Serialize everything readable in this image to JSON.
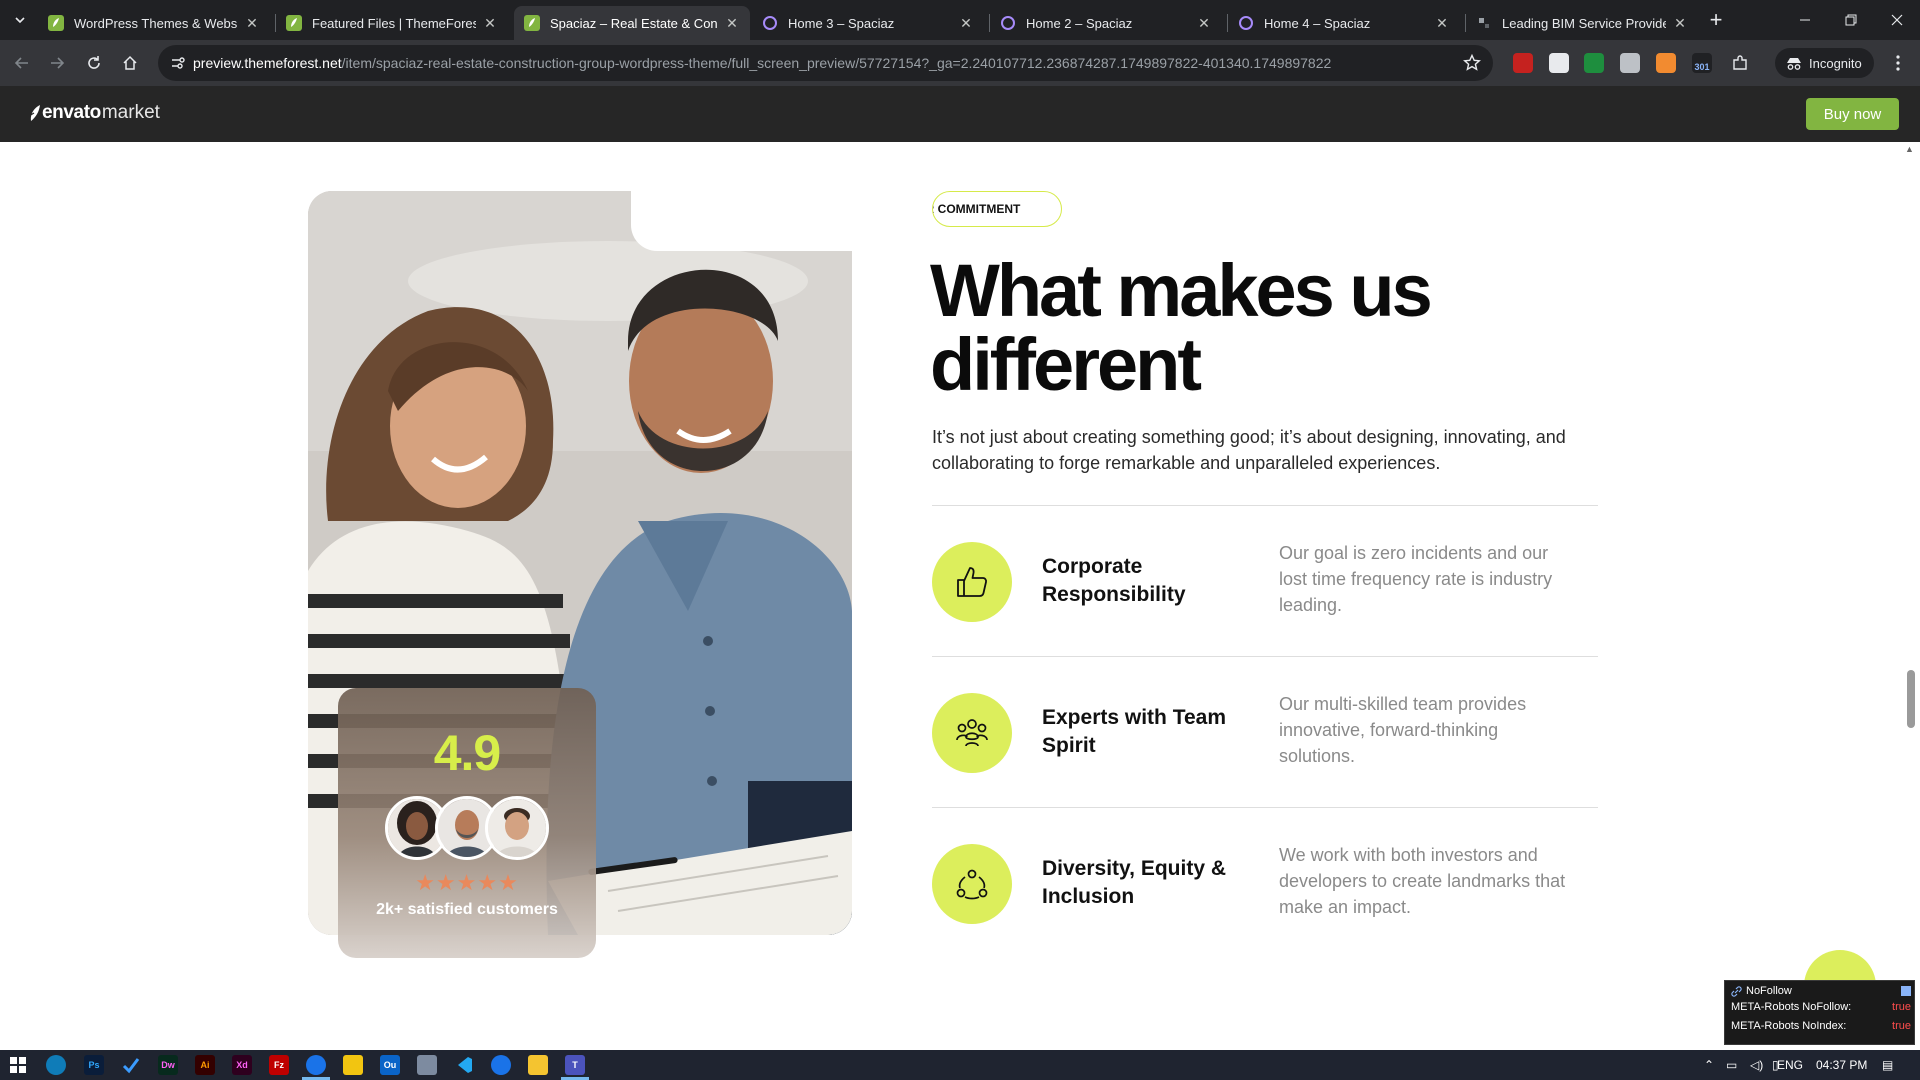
{
  "browser": {
    "tabs": [
      {
        "title": "WordPress Themes & Website Templates",
        "favicon": "envato-leaf-icon",
        "active": false
      },
      {
        "title": "Featured Files | ThemeForest",
        "favicon": "envato-leaf-icon",
        "active": false
      },
      {
        "title": "Spaciaz – Real Estate & Construction",
        "favicon": "envato-leaf-icon",
        "active": true
      },
      {
        "title": "Home 3 – Spaciaz",
        "favicon": "spaciaz-ring-icon",
        "active": false
      },
      {
        "title": "Home 2 – Spaciaz",
        "favicon": "spaciaz-ring-icon",
        "active": false
      },
      {
        "title": "Home 4 – Spaciaz",
        "favicon": "spaciaz-ring-icon",
        "active": false
      },
      {
        "title": "Leading BIM Service Provider | ",
        "favicon": "bim-icon",
        "active": false
      }
    ],
    "url_domain": "preview.themeforest.net",
    "url_path": "/item/spaciaz-real-estate-construction-group-wordpress-theme/full_screen_preview/57727154?_ga=2.240107712.236874287.1749897822-401340.1749897822",
    "incognito_label": "Incognito",
    "extension_badge": "301"
  },
  "envato": {
    "logo_bold": "envato",
    "logo_light": "market",
    "buy_now": "Buy now",
    "brand_green": "#82b541"
  },
  "page": {
    "pill_label": "R COMMITMENT",
    "headline_line1": "What makes us",
    "headline_line2": "different",
    "lead": "It’s not just about creating something good; it’s about designing, innovating, and collaborating to forge remarkable and unparalleled experiences.",
    "accent_color": "#dcee5c",
    "rating": {
      "score": "4.9",
      "stars": "★★★★★",
      "label": "2k+ satisfied customers"
    },
    "features": [
      {
        "icon": "thumbs-up-icon",
        "title": "Corporate Responsibility",
        "desc": "Our goal is zero incidents and our lost time frequency rate is industry leading."
      },
      {
        "icon": "team-people-icon",
        "title": "Experts with Team Spirit",
        "desc": "Our multi-skilled team provides innovative, forward-thinking solutions."
      },
      {
        "icon": "diversity-circle-icon",
        "title": "Diversity, Equity & Inclusion",
        "desc": "We work with both investors and developers to create landmarks that make an impact."
      }
    ]
  },
  "nofollow_panel": {
    "title": "NoFollow",
    "rows": [
      {
        "label": "META-Robots NoFollow:",
        "value": "true"
      },
      {
        "label": "META-Robots NoIndex:",
        "value": "true"
      }
    ]
  },
  "taskbar": {
    "language": "ENG",
    "time": "04:37 PM"
  }
}
